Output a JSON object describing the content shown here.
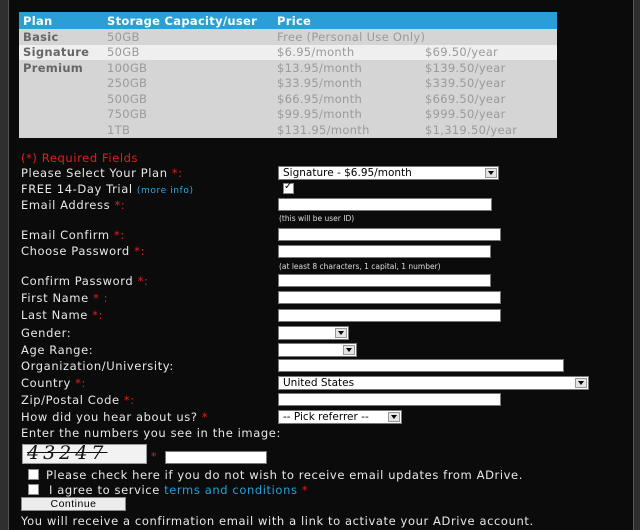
{
  "plan_table": {
    "headers": [
      "Plan",
      "Storage Capacity/user",
      "Price"
    ],
    "rows": [
      {
        "plan": "Basic",
        "storage": "50GB",
        "monthly": "Free (Personal Use Only)",
        "yearly": ""
      },
      {
        "plan": "Signature",
        "storage": "50GB",
        "monthly": "$6.95/month",
        "yearly": "$69.50/year"
      },
      {
        "plan": "Premium",
        "storage": "100GB",
        "monthly": "$13.95/month",
        "yearly": "$139.50/year"
      },
      {
        "plan": "",
        "storage": "250GB",
        "monthly": "$33.95/month",
        "yearly": "$339.50/year"
      },
      {
        "plan": "",
        "storage": "500GB",
        "monthly": "$66.95/month",
        "yearly": "$669.50/year"
      },
      {
        "plan": "",
        "storage": "750GB",
        "monthly": "$99.95/month",
        "yearly": "$999.50/year"
      },
      {
        "plan": "",
        "storage": "1TB",
        "monthly": "$131.95/month",
        "yearly": "$1,319.50/year"
      }
    ]
  },
  "form": {
    "required_note": "(*) Required Fields",
    "plan_label": "Please Select Your Plan",
    "plan_value": "Signature - $6.95/month",
    "trial_label": "FREE 14-Day Trial",
    "trial_more": "(more info)",
    "email_label": "Email Address",
    "email_note": "(this will be user ID)",
    "email_confirm_label": "Email Confirm",
    "password_label": "Choose Password",
    "password_note": "(at least 8 characters, 1 capital, 1 number)",
    "confirm_password_label": "Confirm Password",
    "first_name_label": "First Name",
    "last_name_label": "Last Name",
    "gender_label": "Gender:",
    "age_label": "Age Range:",
    "org_label": "Organization/University:",
    "country_label": "Country",
    "country_value": "United States",
    "zip_label": "Zip/Postal Code",
    "referrer_label": "How did you hear about us?",
    "referrer_value": "-- Pick referrer --",
    "captcha_label": "Enter the numbers you see in the image:",
    "captcha_text": "43247",
    "optout_label": "Please check here if you do not wish to receive email updates from ADrive.",
    "agree_prefix": "I agree to service",
    "agree_link": "terms and conditions",
    "continue_label": "Continue",
    "confirmation_text": "You will receive a confirmation email with a link to activate your ADrive account.",
    "star": "*",
    "star_colon": "*:",
    "star_space_colon": "* :"
  }
}
